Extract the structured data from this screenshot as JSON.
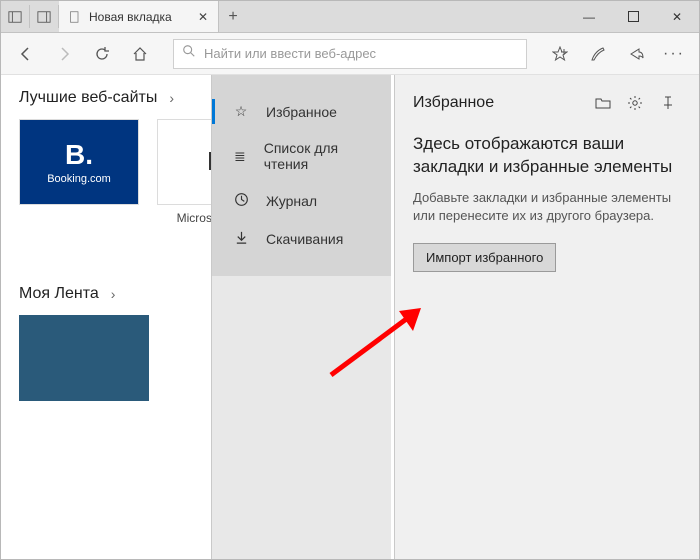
{
  "titlebar": {
    "tab_title": "Новая вкладка",
    "new_tab_tooltip": "+"
  },
  "toolbar": {
    "address_placeholder": "Найти или ввести веб-адрес"
  },
  "ntp": {
    "topsites_heading": "Лучшие веб-сайты",
    "feed_heading": "Моя Лента",
    "tiles": {
      "booking": {
        "logo": "B.",
        "sub": "Booking.com"
      },
      "msstore": {
        "label": "Microsoft Store"
      }
    }
  },
  "hub": {
    "items": {
      "favorites": "Избранное",
      "reading": "Список для чтения",
      "history": "Журнал",
      "downloads": "Скачивания"
    }
  },
  "favpane": {
    "title": "Избранное",
    "heading": "Здесь отображаются ваши закладки и избранные элементы",
    "desc": "Добавьте закладки и избранные элементы или перенесите их из другого браузера.",
    "import_btn": "Импорт избранного"
  }
}
